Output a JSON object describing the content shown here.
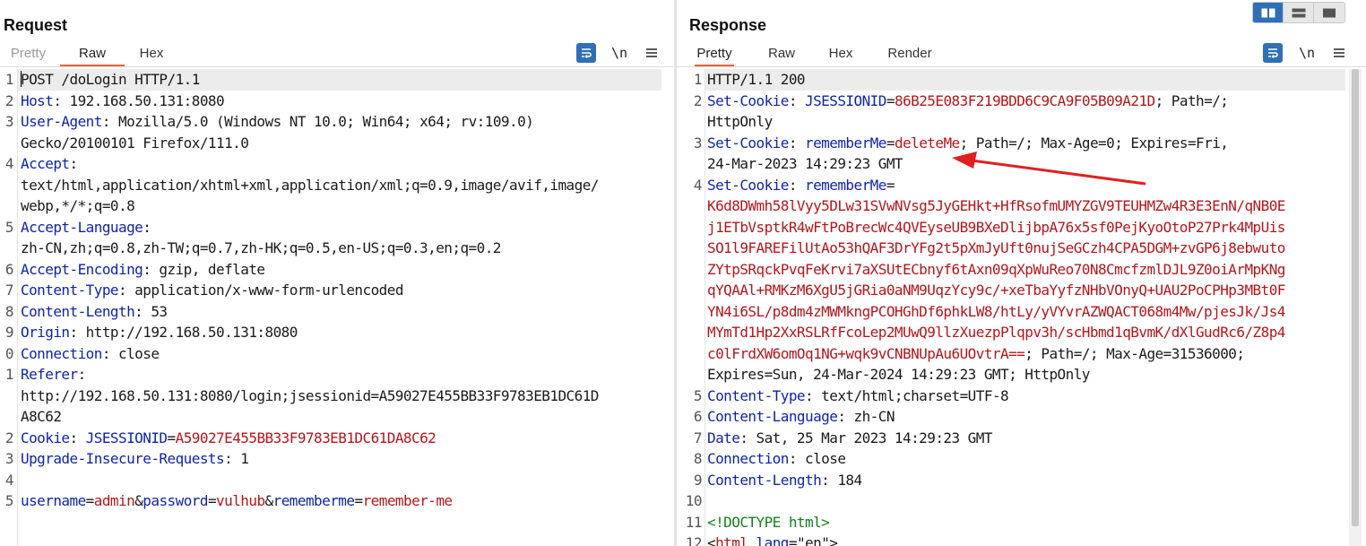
{
  "request": {
    "title": "Request",
    "tabs": [
      "Pretty",
      "Raw",
      "Hex"
    ],
    "active_tab": "Raw",
    "tools": {
      "wrap_icon": "wrap-lines-icon",
      "newline_label": "\\n",
      "menu_icon": "hamburger-menu-icon"
    },
    "lines": [
      {
        "n": "1",
        "segs": [
          {
            "c": "t",
            "s": "POST /doLogin HTTP/1.1"
          }
        ]
      },
      {
        "n": "2",
        "segs": [
          {
            "c": "k",
            "s": "Host"
          },
          {
            "c": "t",
            "s": ": 192.168.50.131:8080"
          }
        ]
      },
      {
        "n": "3",
        "segs": [
          {
            "c": "k",
            "s": "User-Agent"
          },
          {
            "c": "t",
            "s": ": Mozilla/5.0 (Windows NT 10.0; Win64; x64; rv:109.0)"
          }
        ]
      },
      {
        "n": "",
        "segs": [
          {
            "c": "t",
            "s": "Gecko/20100101 Firefox/111.0"
          }
        ]
      },
      {
        "n": "4",
        "segs": [
          {
            "c": "k",
            "s": "Accept"
          },
          {
            "c": "t",
            "s": ":"
          }
        ]
      },
      {
        "n": "",
        "segs": [
          {
            "c": "t",
            "s": "text/html,application/xhtml+xml,application/xml;q=0.9,image/avif,image/"
          }
        ]
      },
      {
        "n": "",
        "segs": [
          {
            "c": "t",
            "s": "webp,*/*;q=0.8"
          }
        ]
      },
      {
        "n": "5",
        "segs": [
          {
            "c": "k",
            "s": "Accept-Language"
          },
          {
            "c": "t",
            "s": ":"
          }
        ]
      },
      {
        "n": "",
        "segs": [
          {
            "c": "t",
            "s": "zh-CN,zh;q=0.8,zh-TW;q=0.7,zh-HK;q=0.5,en-US;q=0.3,en;q=0.2"
          }
        ]
      },
      {
        "n": "6",
        "segs": [
          {
            "c": "k",
            "s": "Accept-Encoding"
          },
          {
            "c": "t",
            "s": ": gzip, deflate"
          }
        ]
      },
      {
        "n": "7",
        "segs": [
          {
            "c": "k",
            "s": "Content-Type"
          },
          {
            "c": "t",
            "s": ": application/x-www-form-urlencoded"
          }
        ]
      },
      {
        "n": "8",
        "segs": [
          {
            "c": "k",
            "s": "Content-Length"
          },
          {
            "c": "t",
            "s": ": 53"
          }
        ]
      },
      {
        "n": "9",
        "segs": [
          {
            "c": "k",
            "s": "Origin"
          },
          {
            "c": "t",
            "s": ": http://192.168.50.131:8080"
          }
        ]
      },
      {
        "n": "0",
        "segs": [
          {
            "c": "k",
            "s": "Connection"
          },
          {
            "c": "t",
            "s": ": close"
          }
        ]
      },
      {
        "n": "1",
        "segs": [
          {
            "c": "k",
            "s": "Referer"
          },
          {
            "c": "t",
            "s": ":"
          }
        ]
      },
      {
        "n": "",
        "segs": [
          {
            "c": "t",
            "s": "http://192.168.50.131:8080/login;jsessionid=A59027E455BB33F9783EB1DC61D"
          }
        ]
      },
      {
        "n": "",
        "segs": [
          {
            "c": "t",
            "s": "A8C62"
          }
        ]
      },
      {
        "n": "2",
        "segs": [
          {
            "c": "k",
            "s": "Cookie"
          },
          {
            "c": "t",
            "s": ": "
          },
          {
            "c": "k",
            "s": "JSESSIONID"
          },
          {
            "c": "t",
            "s": "="
          },
          {
            "c": "v",
            "s": "A59027E455BB33F9783EB1DC61DA8C62"
          }
        ]
      },
      {
        "n": "3",
        "segs": [
          {
            "c": "k",
            "s": "Upgrade-Insecure-Requests"
          },
          {
            "c": "t",
            "s": ": 1"
          }
        ]
      },
      {
        "n": "4",
        "segs": []
      },
      {
        "n": "5",
        "segs": [
          {
            "c": "k",
            "s": "username"
          },
          {
            "c": "t",
            "s": "="
          },
          {
            "c": "v",
            "s": "admin"
          },
          {
            "c": "t",
            "s": "&"
          },
          {
            "c": "k",
            "s": "password"
          },
          {
            "c": "t",
            "s": "="
          },
          {
            "c": "v",
            "s": "vulhub"
          },
          {
            "c": "t",
            "s": "&"
          },
          {
            "c": "k",
            "s": "rememberme"
          },
          {
            "c": "t",
            "s": "="
          },
          {
            "c": "v",
            "s": "remember-me"
          }
        ]
      }
    ]
  },
  "response": {
    "title": "Response",
    "tabs": [
      "Pretty",
      "Raw",
      "Hex",
      "Render"
    ],
    "active_tab": "Pretty",
    "layout_toggle": [
      "side-by-side-layout-icon",
      "stacked-layout-icon",
      "single-pane-layout-icon"
    ],
    "tools": {
      "wrap_icon": "wrap-lines-icon",
      "newline_label": "\\n",
      "menu_icon": "hamburger-menu-icon"
    },
    "lines": [
      {
        "n": "1",
        "segs": [
          {
            "c": "t",
            "s": "HTTP/1.1 200"
          }
        ]
      },
      {
        "n": "2",
        "segs": [
          {
            "c": "k",
            "s": "Set-Cookie"
          },
          {
            "c": "t",
            "s": ": "
          },
          {
            "c": "k",
            "s": "JSESSIONID"
          },
          {
            "c": "t",
            "s": "="
          },
          {
            "c": "v",
            "s": "86B25E083F219BDD6C9CA9F05B09A21D"
          },
          {
            "c": "t",
            "s": "; Path=/;"
          }
        ]
      },
      {
        "n": "",
        "segs": [
          {
            "c": "t",
            "s": "HttpOnly"
          }
        ]
      },
      {
        "n": "3",
        "segs": [
          {
            "c": "k",
            "s": "Set-Cookie"
          },
          {
            "c": "t",
            "s": ": "
          },
          {
            "c": "k",
            "s": "rememberMe"
          },
          {
            "c": "t",
            "s": "="
          },
          {
            "c": "v",
            "s": "deleteMe"
          },
          {
            "c": "t",
            "s": "; Path=/; Max-Age=0; Expires=Fri,"
          }
        ]
      },
      {
        "n": "",
        "segs": [
          {
            "c": "t",
            "s": "24-Mar-2023 14:29:23 GMT"
          }
        ]
      },
      {
        "n": "4",
        "segs": [
          {
            "c": "k",
            "s": "Set-Cookie"
          },
          {
            "c": "t",
            "s": ": "
          },
          {
            "c": "k",
            "s": "rememberMe"
          },
          {
            "c": "t",
            "s": "="
          }
        ]
      },
      {
        "n": "",
        "segs": [
          {
            "c": "v",
            "s": "K6d8DWmh58lVyy5DLw31SVwNVsg5JyGEHkt+HfRsofmUMYZGV9TEUHMZw4R3E3EnN/qNB0E"
          }
        ]
      },
      {
        "n": "",
        "segs": [
          {
            "c": "v",
            "s": "j1ETbVsptkR4wFtPoBrecWc4QVEyseUB9BXeDlijbpA76x5sf0PejKyoOtoP27Prk4MpUis"
          }
        ]
      },
      {
        "n": "",
        "segs": [
          {
            "c": "v",
            "s": "SO1l9FAREFilUtAo53hQAF3DrYFg2t5pXmJyUft0nujSeGCzh4CPA5DGM+zvGP6j8ebwuto"
          }
        ]
      },
      {
        "n": "",
        "segs": [
          {
            "c": "v",
            "s": "ZYtpSRqckPvqFeKrvi7aXSUtECbnyf6tAxn09qXpWuReo70N8CmcfzmlDJL9Z0oiArMpKNg"
          }
        ]
      },
      {
        "n": "",
        "segs": [
          {
            "c": "v",
            "s": "qYQAAl+RMKzM6XgU5jGRia0aNM9UqzYcy9c/+xeTbaYyfzNHbVOnyQ+UAU2PoCPHp3MBt0F"
          }
        ]
      },
      {
        "n": "",
        "segs": [
          {
            "c": "v",
            "s": "YN4i6SL/p8dm4zMWMkngPCOHGhDf6phkLW8/htLy/yVYvrAZWQACT068m4Mw/pjesJk/Js4"
          }
        ]
      },
      {
        "n": "",
        "segs": [
          {
            "c": "v",
            "s": "MYmTd1Hp2XxRSLRfFcoLep2MUwQ9llzXuezpPlqpv3h/scHbmd1qBvmK/dXlGudRc6/Z8p4"
          }
        ]
      },
      {
        "n": "",
        "segs": [
          {
            "c": "v",
            "s": "c0lFrdXW6omOq1NG+wqk9vCNBNUpAu6UOvtrA=="
          },
          {
            "c": "t",
            "s": "; Path=/; Max-Age=31536000;"
          }
        ]
      },
      {
        "n": "",
        "segs": [
          {
            "c": "t",
            "s": "Expires=Sun, 24-Mar-2024 14:29:23 GMT; HttpOnly"
          }
        ]
      },
      {
        "n": "5",
        "segs": [
          {
            "c": "k",
            "s": "Content-Type"
          },
          {
            "c": "t",
            "s": ": text/html;charset=UTF-8"
          }
        ]
      },
      {
        "n": "6",
        "segs": [
          {
            "c": "k",
            "s": "Content-Language"
          },
          {
            "c": "t",
            "s": ": zh-CN"
          }
        ]
      },
      {
        "n": "7",
        "segs": [
          {
            "c": "k",
            "s": "Date"
          },
          {
            "c": "t",
            "s": ": Sat, 25 Mar 2023 14:29:23 GMT"
          }
        ]
      },
      {
        "n": "8",
        "segs": [
          {
            "c": "k",
            "s": "Connection"
          },
          {
            "c": "t",
            "s": ": close"
          }
        ]
      },
      {
        "n": "9",
        "segs": [
          {
            "c": "k",
            "s": "Content-Length"
          },
          {
            "c": "t",
            "s": ": 184"
          }
        ]
      },
      {
        "n": "10",
        "segs": []
      },
      {
        "n": "11",
        "segs": [
          {
            "c": "g",
            "s": "<!DOCTYPE html>"
          }
        ]
      },
      {
        "n": "12",
        "segs": [
          {
            "c": "t",
            "s": "<"
          },
          {
            "c": "v",
            "s": "html"
          },
          {
            "c": "t",
            "s": " "
          },
          {
            "c": "k",
            "s": "lang"
          },
          {
            "c": "t",
            "s": "=\"en\">"
          }
        ]
      }
    ]
  },
  "annotation": {
    "type": "red-arrow",
    "color": "#e02020",
    "points_to": "deleteMe expiry line"
  },
  "colors": {
    "key": "#0f24a8",
    "value": "#b3161b",
    "doctype": "#16801a",
    "accent": "#e8643a",
    "brand": "#2f6fb6"
  }
}
